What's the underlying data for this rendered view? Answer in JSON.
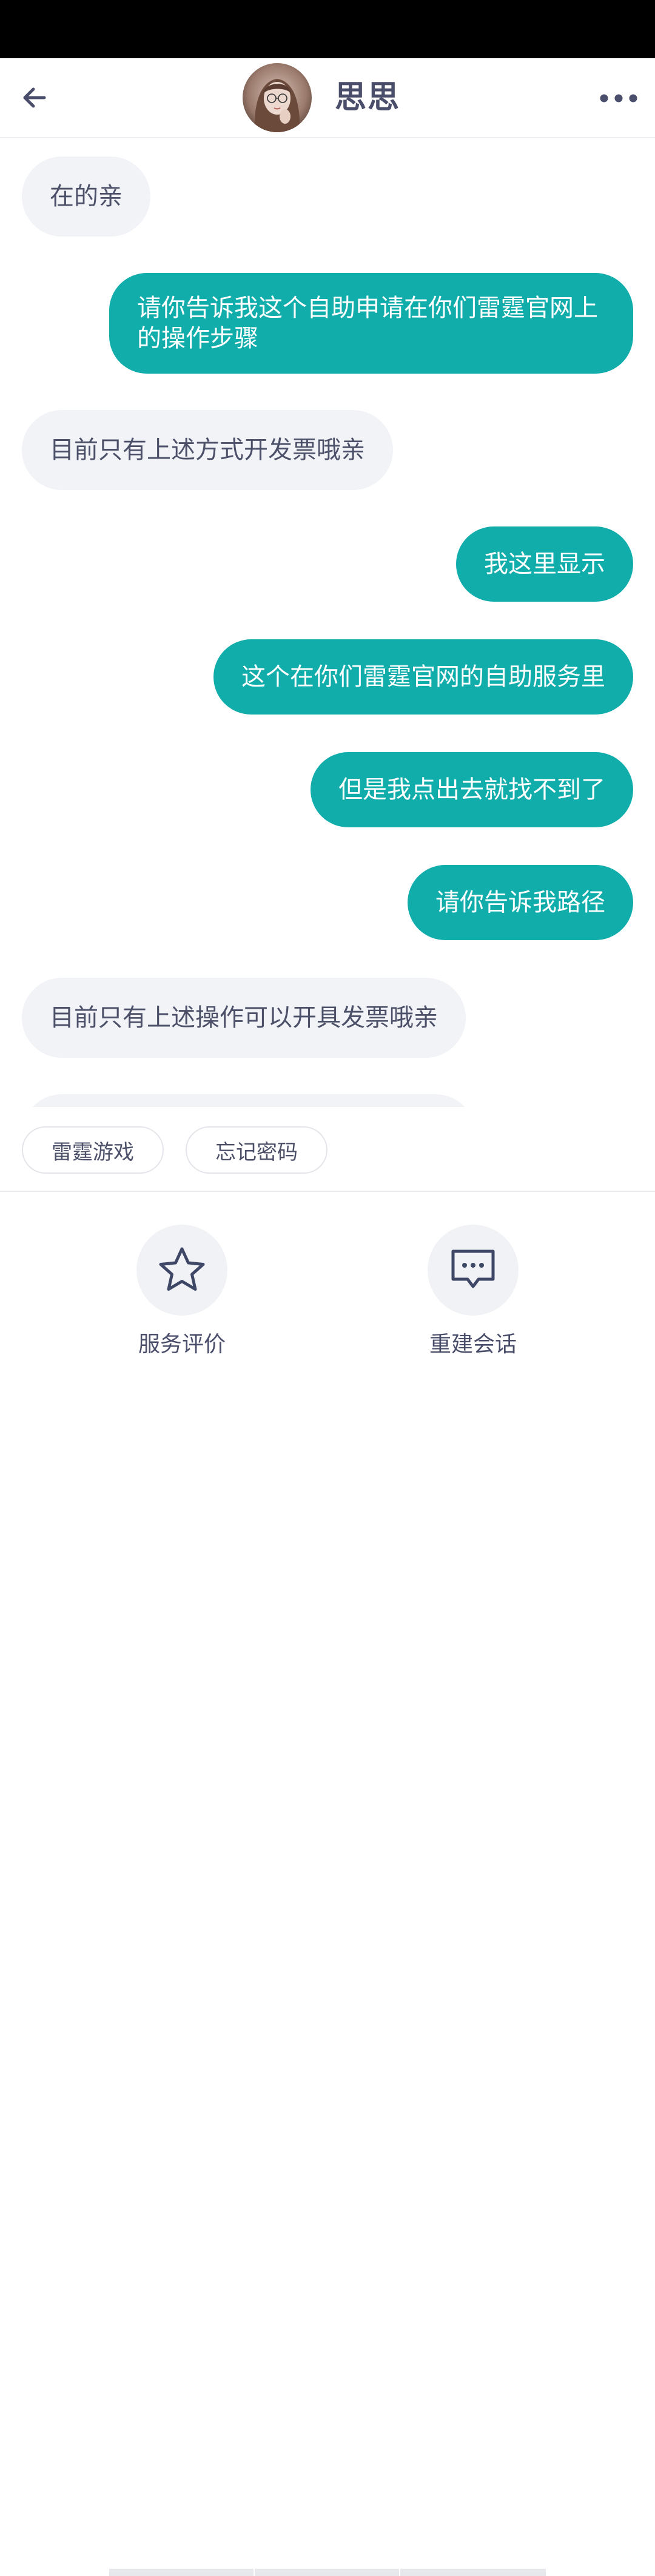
{
  "header": {
    "title": "思思",
    "back_icon": "back-arrow-icon",
    "more_icon": "more-dots-icon",
    "avatar": "agent-avatar"
  },
  "messages": [
    {
      "side": "in",
      "text": "在的亲"
    },
    {
      "side": "out",
      "text": "请你告诉我这个自助申请在你们雷霆官网上的操作步骤"
    },
    {
      "side": "in",
      "text": "目前只有上述方式开发票哦亲"
    },
    {
      "side": "out",
      "text": "我这里显示"
    },
    {
      "side": "out",
      "text": "这个在你们雷霆官网的自助服务里"
    },
    {
      "side": "out",
      "text": "但是我点出去就找不到了"
    },
    {
      "side": "out",
      "text": "请你告诉我路径"
    },
    {
      "side": "in",
      "text": "目前只有上述操作可以开具发票哦亲"
    }
  ],
  "quick_replies": [
    "雷霆游戏",
    "忘记密码"
  ],
  "actions": {
    "rate": {
      "label": "服务评价",
      "icon": "star-icon"
    },
    "restart": {
      "label": "重建会话",
      "icon": "chat-bubble-icon"
    }
  },
  "colors": {
    "outgoing_bubble": "#11adab",
    "incoming_bubble": "#f1f3f7",
    "text_dark": "#4c5068"
  }
}
